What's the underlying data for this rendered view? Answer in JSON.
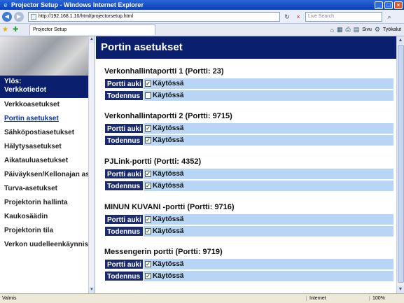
{
  "window": {
    "title": "Projector Setup - Windows Internet Explorer"
  },
  "address": {
    "url": "http://192.168.1.10/html/projectorsetup.html",
    "search_placeholder": "Live Search"
  },
  "tab": {
    "label": "Projector Setup"
  },
  "tools": {
    "page_label": "Sivu",
    "tools_label": "Työkalut"
  },
  "sidebar": {
    "up_label": "Ylös:\nVerkkotiedot",
    "items": [
      {
        "label": "Verkkoasetukset"
      },
      {
        "label": "Portin asetukset"
      },
      {
        "label": "Sähköpostiasetukset"
      },
      {
        "label": "Hälytysasetukset"
      },
      {
        "label": "Aikatauluasetukset"
      },
      {
        "label": "Päiväyksen/Kellonajan asetukset"
      },
      {
        "label": "Turva-asetukset"
      },
      {
        "label": "Projektorin hallinta"
      },
      {
        "label": "Kaukosäädin"
      },
      {
        "label": "Projektorin tila"
      },
      {
        "label": "Verkon uudelleenkäynnistys"
      }
    ]
  },
  "main": {
    "header": "Portin asetukset",
    "sections": [
      {
        "title": "Verkonhallintaportti 1 (Portti: 23)",
        "rows": [
          {
            "label": "Portti auki",
            "checked": true,
            "value": "Käytössä"
          },
          {
            "label": "Todennus",
            "checked": false,
            "value": "Käytössä"
          }
        ]
      },
      {
        "title": "Verkonhallintaportti 2 (Portti: 9715)",
        "rows": [
          {
            "label": "Portti auki",
            "checked": true,
            "value": "Käytössä"
          },
          {
            "label": "Todennus",
            "checked": true,
            "value": "Käytössä"
          }
        ]
      },
      {
        "title": "PJLink-portti (Portti: 4352)",
        "rows": [
          {
            "label": "Portti auki",
            "checked": true,
            "value": "Käytössä"
          },
          {
            "label": "Todennus",
            "checked": true,
            "value": "Käytössä"
          }
        ]
      },
      {
        "title": "MINUN KUVANI -portti (Portti: 9716)",
        "rows": [
          {
            "label": "Portti auki",
            "checked": true,
            "value": "Käytössä"
          },
          {
            "label": "Todennus",
            "checked": true,
            "value": "Käytössä"
          }
        ]
      },
      {
        "title": "Messengerin portti (Portti: 9719)",
        "rows": [
          {
            "label": "Portti auki",
            "checked": true,
            "value": "Käytössä"
          },
          {
            "label": "Todennus",
            "checked": true,
            "value": "Käytössä"
          }
        ]
      }
    ]
  },
  "status": {
    "text": "Valmis",
    "zone": "Internet",
    "zoom": "100%"
  }
}
